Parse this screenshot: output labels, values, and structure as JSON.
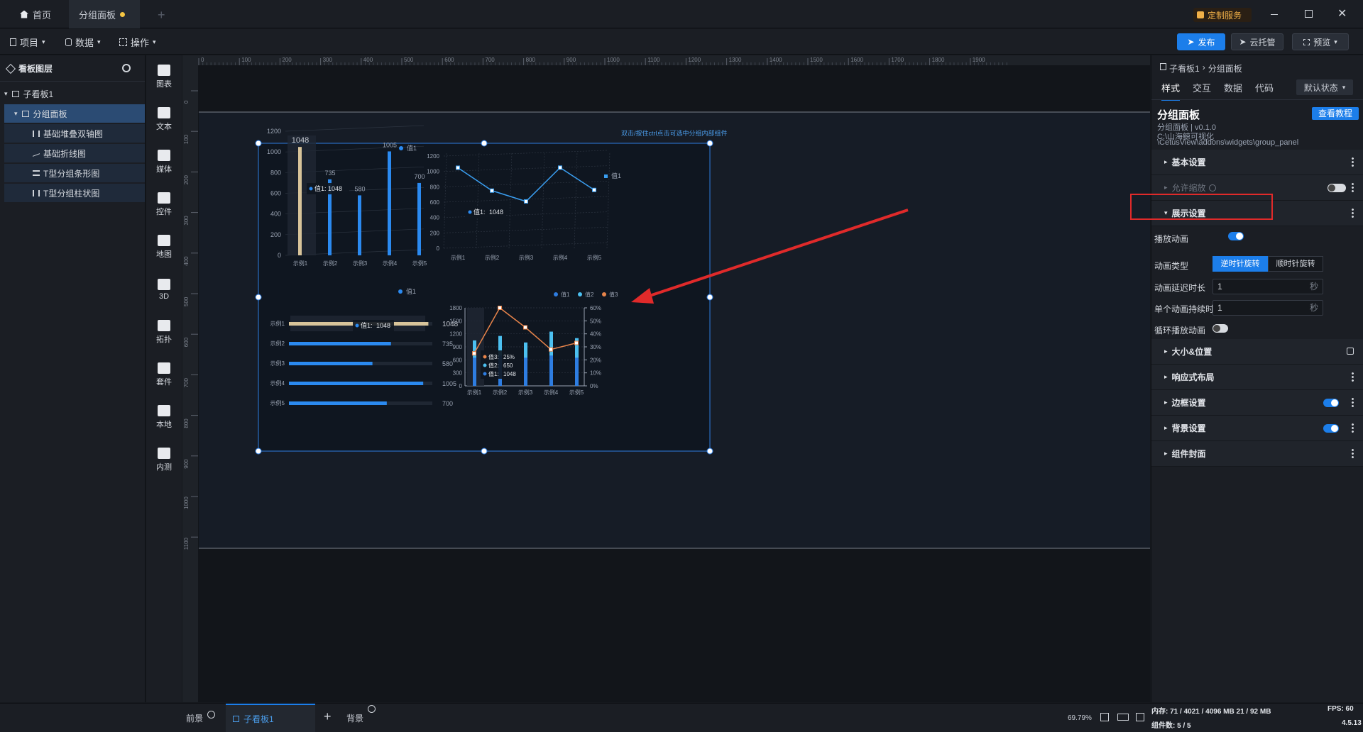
{
  "titlebar": {
    "tabs": [
      {
        "label": "首页"
      },
      {
        "label": "分组面板"
      }
    ],
    "service_label": "定制服务"
  },
  "menubar": {
    "items": [
      {
        "label": "项目"
      },
      {
        "label": "数据"
      },
      {
        "label": "操作"
      }
    ],
    "publish_label": "发布",
    "cloud_label": "云托管",
    "preview_label": "预览"
  },
  "layers": {
    "title": "看板图层",
    "root": "子看板1",
    "group": "分组面板",
    "children": [
      {
        "label": "基础堆叠双轴图"
      },
      {
        "label": "基础折线图"
      },
      {
        "label": "T型分组条形图"
      },
      {
        "label": "T型分组柱状图"
      }
    ]
  },
  "toolbar": {
    "items": [
      {
        "label": "图表"
      },
      {
        "label": "文本"
      },
      {
        "label": "媒体"
      },
      {
        "label": "控件"
      },
      {
        "label": "地图"
      },
      {
        "label": "3D"
      },
      {
        "label": "拓扑"
      },
      {
        "label": "套件"
      },
      {
        "label": "本地"
      },
      {
        "label": "内测"
      }
    ]
  },
  "ruler": {
    "h_ticks": [
      "0",
      "100",
      "200",
      "300",
      "400",
      "500",
      "600",
      "700",
      "800",
      "900",
      "1000",
      "1100",
      "1200",
      "1300",
      "1400",
      "1500",
      "1600",
      "1700",
      "1800",
      "1900"
    ],
    "v_ticks": [
      "0",
      "100",
      "200",
      "300",
      "400",
      "500",
      "600",
      "700",
      "800",
      "900",
      "1000",
      "1100"
    ]
  },
  "canvas": {
    "hint": "双击/按住ctrl点击可选中分组内部组件",
    "chart1": {
      "legend": "值1",
      "categories": [
        "示例1",
        "示例2",
        "示例3",
        "示例4",
        "示例5"
      ],
      "values": [
        1048,
        735,
        580,
        1005,
        700
      ],
      "y_ticks": [
        "0",
        "200",
        "400",
        "600",
        "800",
        "1000",
        "1200"
      ],
      "tooltip_label": "值1:",
      "tooltip_value": "1048"
    },
    "chart2": {
      "legend": "值1",
      "categories": [
        "示例1",
        "示例2",
        "示例3",
        "示例4",
        "示例5"
      ],
      "values": [
        1048,
        735,
        580,
        1005,
        700
      ],
      "y_ticks": [
        "0",
        "200",
        "400",
        "600",
        "800",
        "1000",
        "1200"
      ],
      "tooltip_label": "值1:",
      "tooltip_value": "1048"
    },
    "chart3": {
      "legend": "值1",
      "categories": [
        "示例1",
        "示例2",
        "示例3",
        "示例4",
        "示例5"
      ],
      "values": [
        1048,
        735,
        580,
        1005,
        700
      ],
      "tooltip_label": "值1:",
      "tooltip_value": "1048"
    },
    "chart4": {
      "legends": [
        {
          "label": "值1"
        },
        {
          "label": "值2"
        },
        {
          "label": "值3"
        }
      ],
      "categories": [
        "示例1",
        "示例2",
        "示例3",
        "示例4",
        "示例5"
      ],
      "y_ticks": [
        "0",
        "300",
        "600",
        "900",
        "1200",
        "1500",
        "1800"
      ],
      "y2_ticks": [
        "0%",
        "10%",
        "20%",
        "30%",
        "40%",
        "50%",
        "60%"
      ],
      "tooltip": [
        {
          "label": "值3:",
          "value": "25%"
        },
        {
          "label": "值2:",
          "value": "650"
        },
        {
          "label": "值1:",
          "value": "1048"
        }
      ]
    }
  },
  "chart_data": [
    {
      "type": "bar",
      "categories": [
        "示例1",
        "示例2",
        "示例3",
        "示例4",
        "示例5"
      ],
      "series": [
        {
          "name": "值1",
          "values": [
            1048,
            735,
            580,
            1005,
            700
          ]
        }
      ],
      "ylim": [
        0,
        1200
      ]
    },
    {
      "type": "line",
      "categories": [
        "示例1",
        "示例2",
        "示例3",
        "示例4",
        "示例5"
      ],
      "series": [
        {
          "name": "值1",
          "values": [
            1048,
            735,
            580,
            1005,
            700
          ]
        }
      ],
      "ylim": [
        0,
        1200
      ]
    },
    {
      "type": "bar",
      "categories": [
        "示例1",
        "示例2",
        "示例3",
        "示例4",
        "示例5"
      ],
      "series": [
        {
          "name": "值1",
          "values": [
            1048,
            735,
            580,
            1005,
            700
          ]
        }
      ]
    },
    {
      "type": "bar",
      "categories": [
        "示例1",
        "示例2",
        "示例3",
        "示例4",
        "示例5"
      ],
      "series": [
        {
          "name": "值1",
          "values": [
            1048,
            1150,
            1000,
            1250,
            1100
          ]
        },
        {
          "name": "值2",
          "values": [
            650,
            700,
            650,
            700,
            650
          ]
        },
        {
          "name": "值3",
          "values": [
            0.25,
            0.6,
            0.45,
            0.28,
            0.33
          ]
        }
      ],
      "ylim": [
        0,
        1800
      ]
    }
  ],
  "bottom": {
    "front_label": "前景",
    "board_tab": "子看板1",
    "back_label": "背景",
    "zoom": "69.79%",
    "memory_label": "内存: 71 / 4021 / 4096 MB  21 / 92 MB",
    "fps_label": "FPS: 60",
    "components_label": "组件数: 5 / 5",
    "version": "4.5.13"
  },
  "props": {
    "breadcrumb_parent": "子看板1",
    "breadcrumb_current": "分组面板",
    "tabs": [
      {
        "label": "样式"
      },
      {
        "label": "交互"
      },
      {
        "label": "数据"
      },
      {
        "label": "代码"
      }
    ],
    "state_select": "默认状态",
    "title": "分组面板",
    "tutorial_label": "查看教程",
    "version_line": "分组面板 | v0.1.0",
    "path_line1": "C:\\山海鲸可视化",
    "path_line2": "\\CetusView\\addons\\widgets\\group_panel",
    "sections": {
      "basic": "基本设置",
      "allow_zoom": "允许缩放",
      "display": "展示设置",
      "size_pos": "大小&位置",
      "responsive": "响应式布局",
      "border": "边框设置",
      "background": "背景设置",
      "cover": "组件封面"
    },
    "play_animation": "播放动画",
    "animation_type": "动画类型",
    "anim_options": [
      {
        "label": "逆时针旋转"
      },
      {
        "label": "顺时针旋转"
      }
    ],
    "delay_label": "动画延迟时长",
    "delay_value": "1",
    "duration_label": "单个动画持续时长",
    "duration_value": "1",
    "seconds_unit": "秒",
    "loop_label": "循环播放动画"
  },
  "colors": {
    "accent": "#1c7eea",
    "highlight": "#e02a2a",
    "panel": "#1b1e24"
  }
}
